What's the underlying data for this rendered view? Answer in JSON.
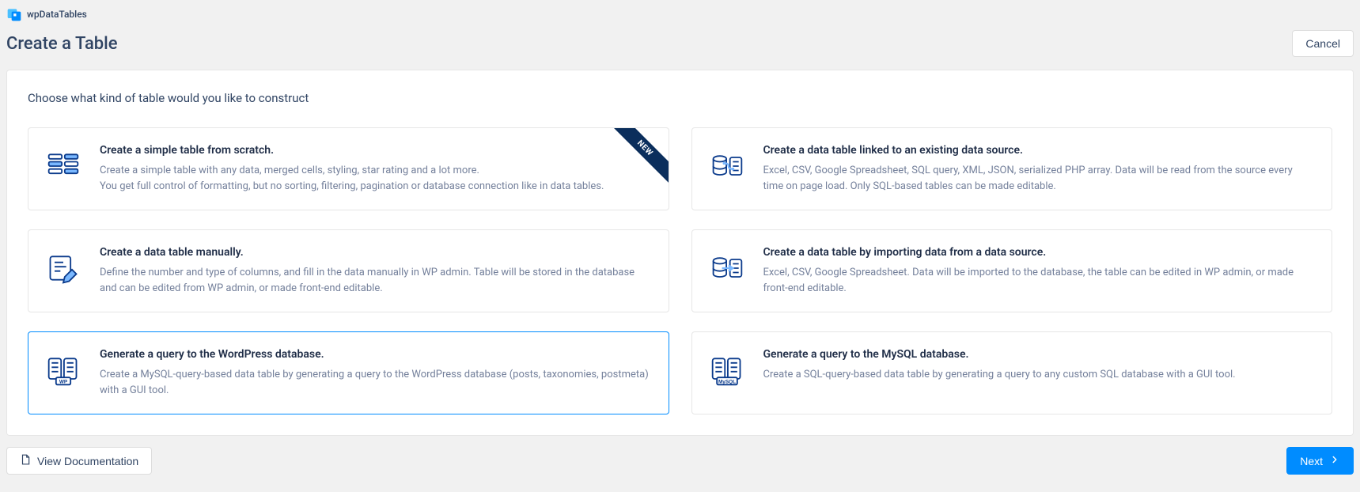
{
  "brand": {
    "name": "wpDataTables"
  },
  "header": {
    "title": "Create a Table",
    "cancel": "Cancel"
  },
  "section": {
    "title": "Choose what kind of table would you like to construct"
  },
  "cards": [
    {
      "title": "Create a simple table from scratch.",
      "desc": "Create a simple table with any data, merged cells, styling, star rating and a lot more.\nYou get full control of formatting, but no sorting, filtering, pagination or database connection like in data tables.",
      "badge": "NEW"
    },
    {
      "title": "Create a data table linked to an existing data source.",
      "desc": "Excel, CSV, Google Spreadsheet, SQL query, XML, JSON, serialized PHP array. Data will be read from the source every time on page load. Only SQL-based tables can be made editable."
    },
    {
      "title": "Create a data table manually.",
      "desc": "Define the number and type of columns, and fill in the data manually in WP admin. Table will be stored in the database and can be edited from WP admin, or made front-end editable."
    },
    {
      "title": "Create a data table by importing data from a data source.",
      "desc": "Excel, CSV, Google Spreadsheet. Data will be imported to the database, the table can be edited in WP admin, or made front-end editable."
    },
    {
      "title": "Generate a query to the WordPress database.",
      "desc": "Create a MySQL-query-based data table by generating a query to the WordPress database (posts, taxonomies, postmeta) with a GUI tool."
    },
    {
      "title": "Generate a query to the MySQL database.",
      "desc": "Create a SQL-query-based data table by generating a query to any custom SQL database with a GUI tool."
    }
  ],
  "footer": {
    "docs": "View Documentation",
    "next": "Next"
  },
  "labels": {
    "wp": "WP",
    "mysql": "MySQL"
  }
}
